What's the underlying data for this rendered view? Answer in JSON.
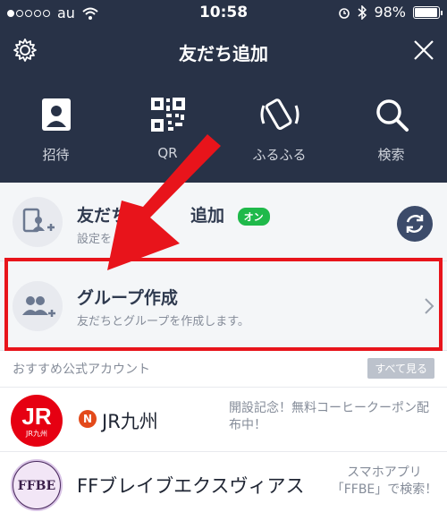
{
  "status_bar": {
    "carrier": "au",
    "time": "10:58",
    "battery": "98%",
    "battery_level": 0.98
  },
  "nav": {
    "title": "友だち追加",
    "settings_icon": "gear-icon",
    "close_icon": "close-icon"
  },
  "tools": [
    {
      "label": "招待",
      "icon": "invite-icon"
    },
    {
      "label": "QR",
      "icon": "qr-code-icon"
    },
    {
      "label": "ふるふる",
      "icon": "shake-icon"
    },
    {
      "label": "検索",
      "icon": "search-icon"
    }
  ],
  "auto_add": {
    "title_visible": "友だち",
    "title_end": "追加",
    "toggle": "オン",
    "subtitle": "設定を"
  },
  "create_group": {
    "title": "グループ作成",
    "subtitle": "友だちとグループを作成します。"
  },
  "recommended": {
    "title": "おすすめ公式アカウント",
    "see_all": "すべて見る"
  },
  "accounts": [
    {
      "name": "JR九州",
      "badge": "N",
      "logo_text": "JR",
      "logo_sub": "JR九州",
      "desc": "開設記念！無料コーヒークーポン配布中！"
    },
    {
      "name": "FFブレイブエクスヴィアス",
      "logo_text": "FFBE",
      "desc_line1": "スマホアプリ",
      "desc_line2": "「FFBE」で検索！"
    }
  ],
  "colors": {
    "header_bg": "#283247",
    "highlight": "#e8141b",
    "toggle_green": "#1fb94a",
    "jr_red": "#e60012"
  }
}
